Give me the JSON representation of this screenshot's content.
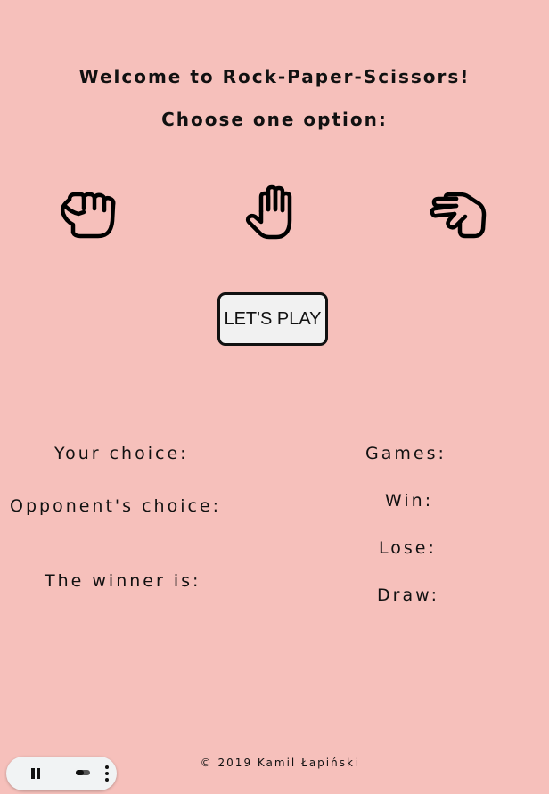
{
  "header": {
    "title": "Welcome to Rock-Paper-Scissors!",
    "subtitle": "Choose one option:"
  },
  "options": [
    {
      "name": "rock",
      "icon": "hand-rock-icon"
    },
    {
      "name": "paper",
      "icon": "hand-paper-icon"
    },
    {
      "name": "scissors",
      "icon": "hand-scissors-icon"
    }
  ],
  "play_button": {
    "label": "LET'S PLAY"
  },
  "results": {
    "your_choice_label": "Your choice:",
    "opponent_choice_label": "Opponent's choice:",
    "winner_label": "The winner is:"
  },
  "score": {
    "games_label": "Games:",
    "win_label": "Win:",
    "lose_label": "Lose:",
    "draw_label": "Draw:"
  },
  "footer": {
    "text": "© 2019 Kamil Łapiński"
  },
  "media_controls": {
    "icons": [
      "pause-icon",
      "toggle-icon",
      "more-vert-icon"
    ]
  },
  "colors": {
    "background": "#f6c0bb",
    "button_bg": "#f1f1f1",
    "text": "#111111"
  }
}
